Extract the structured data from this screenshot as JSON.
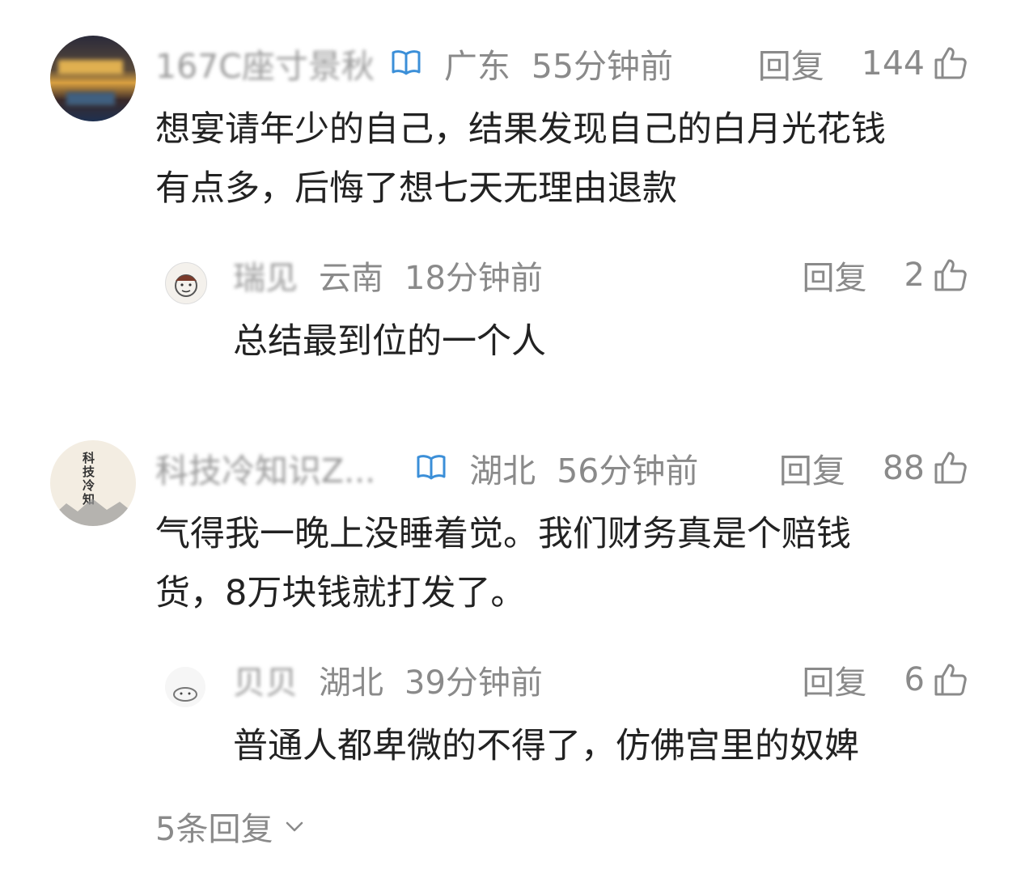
{
  "comments": [
    {
      "username": "167C座寸景秋",
      "location": "广东",
      "time": "55分钟前",
      "reply_label": "回复",
      "likes": "144",
      "text_lines": [
        "想宴请年少的自己，结果发现自己的白月光花钱",
        "有点多，后悔了想七天无理由退款"
      ],
      "reply": {
        "username": "瑞见",
        "location": "云南",
        "time": "18分钟前",
        "reply_label": "回复",
        "likes": "2",
        "text": "总结最到位的一个人"
      }
    },
    {
      "username": "科技冷知识Z...",
      "avatar_text": "科技冷知",
      "location": "湖北",
      "time": "56分钟前",
      "reply_label": "回复",
      "likes": "88",
      "text_lines": [
        "气得我一晚上没睡着觉。我们财务真是个赔钱",
        "货，8万块钱就打发了。"
      ],
      "reply": {
        "username": "贝贝",
        "location": "湖北",
        "time": "39分钟前",
        "reply_label": "回复",
        "likes": "6",
        "text": "普通人都卑微的不得了，仿佛宫里的奴婢"
      }
    }
  ],
  "more_replies_label": "5条回复",
  "colors": {
    "text": "#222222",
    "meta": "#8a8a8a",
    "verified": "#3b8fd8"
  },
  "icons": {
    "verified": "verified-book-icon",
    "like": "thumb-up-icon",
    "expand": "chevron-down-icon"
  }
}
